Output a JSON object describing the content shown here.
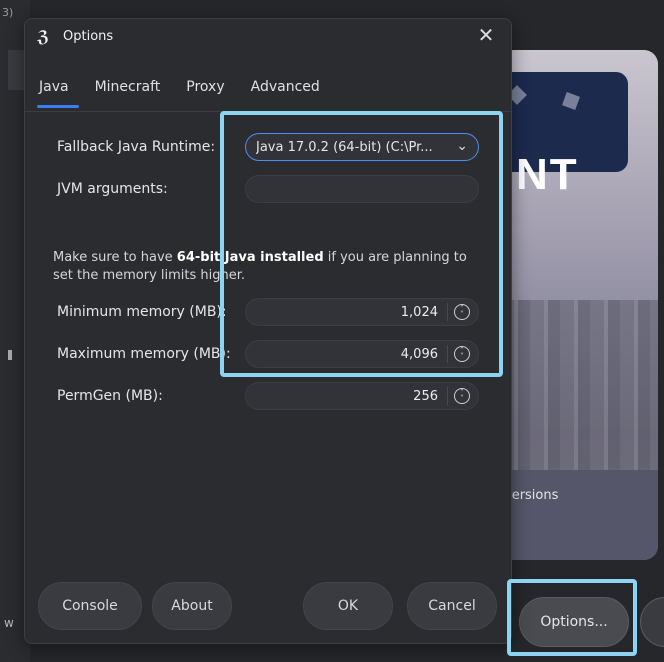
{
  "background": {
    "corner_text": "3)",
    "side_marker": "w",
    "banner_text": "NT",
    "versions_text": "versions",
    "options_button": "Options..."
  },
  "dialog": {
    "title": "Options",
    "app_icon": "ℨ",
    "close_glyph": "✕",
    "tabs": [
      {
        "label": "Java",
        "active": true
      },
      {
        "label": "Minecraft",
        "active": false
      },
      {
        "label": "Proxy",
        "active": false
      },
      {
        "label": "Advanced",
        "active": false
      }
    ],
    "fallback_runtime_label": "Fallback Java Runtime:",
    "fallback_runtime_value": "Java 17.0.2 (64-bit) (C:\\Pr...",
    "jvm_arguments_label": "JVM arguments:",
    "jvm_arguments_value": "",
    "note_prefix": "Make sure to have ",
    "note_bold": "64-bit Java installed",
    "note_suffix": " if you are planning to set the memory limits higher.",
    "min_memory_label": "Minimum memory (MB):",
    "min_memory_value": "1,024",
    "max_memory_label": "Maximum memory (MB):",
    "max_memory_value": "4,096",
    "permgen_label": "PermGen (MB):",
    "permgen_value": "256",
    "buttons": {
      "console": "Console",
      "about": "About",
      "ok": "OK",
      "cancel": "Cancel"
    }
  },
  "colors": {
    "accent": "#3b7df2",
    "highlight": "#8fd3f2"
  }
}
